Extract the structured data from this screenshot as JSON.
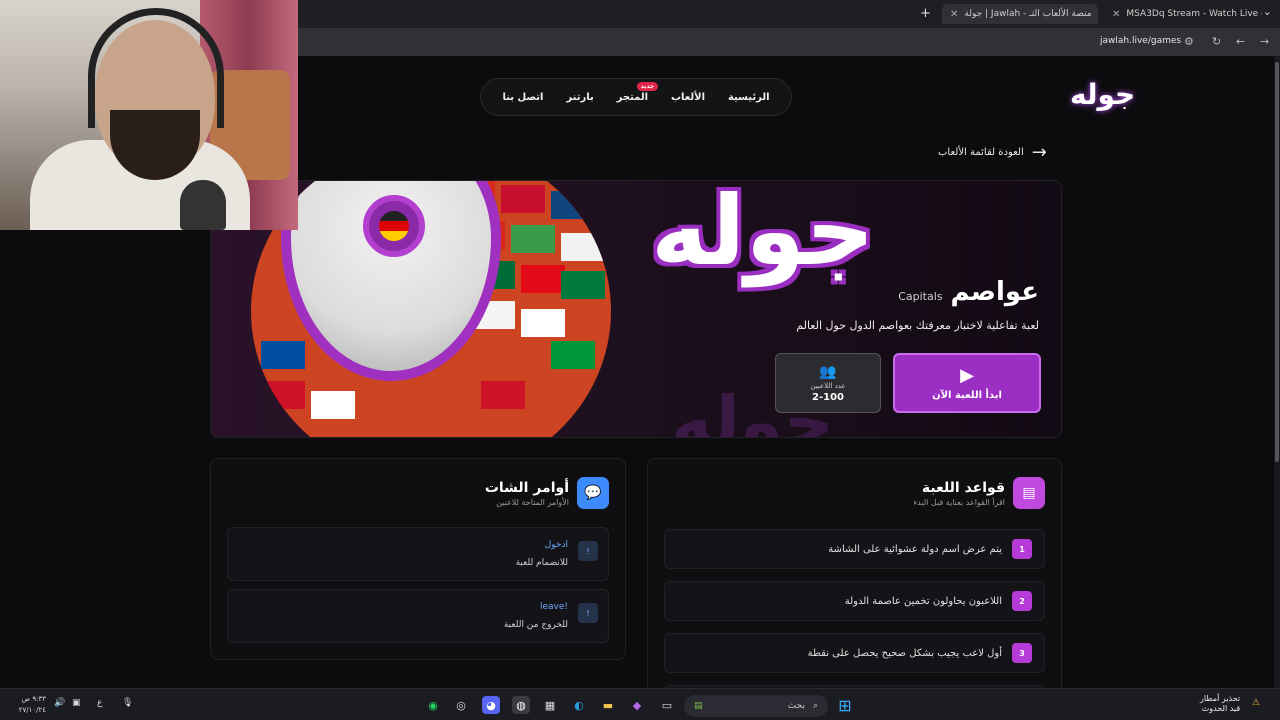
{
  "browser": {
    "tabs": [
      {
        "title": "MSA3Dq Stream - Watch Live o",
        "active": false
      },
      {
        "title": "جولة | Jawlah - منصة الألعاب التـ",
        "active": true
      }
    ],
    "new_tab": "+",
    "url": "jawlah.live/games"
  },
  "site": {
    "logo": "جوله",
    "nav": [
      {
        "label": "الرئيسية"
      },
      {
        "label": "الألعاب"
      },
      {
        "label": "المتجر",
        "badge": "جديد"
      },
      {
        "label": "بارتنر"
      },
      {
        "label": "اتصل بنا"
      }
    ],
    "back_link": "العودة لقائمة الألعاب"
  },
  "hero": {
    "brand_text": "جوله",
    "title_ar": "عواصم",
    "title_en": "Capitals",
    "description": "لعبة تفاعلية لاختبار معرفتك بعواصم الدول حول العالم",
    "start_button": "ابدأ اللعبة الآن",
    "players_label": "عدد اللاعبين",
    "players_value": "2-100"
  },
  "rules_card": {
    "title": "قواعد اللعبة",
    "subtitle": "اقرأ القواعد بعناية قبل البدء",
    "rules": [
      {
        "num": "1",
        "text": "يتم عرض اسم دولة عشوائية على الشاشة"
      },
      {
        "num": "2",
        "text": "اللاعبون يحاولون تخمين عاصمة الدولة"
      },
      {
        "num": "3",
        "text": "أول لاعب يجيب بشكل صحيح يحصل على نقطة"
      }
    ]
  },
  "chat_card": {
    "title": "أوامر الشات",
    "subtitle": "الأوامر المتاحة للاعبين",
    "commands": [
      {
        "num": "!",
        "code": "ادخول",
        "desc": "للانضمام للعبة"
      },
      {
        "num": "!",
        "code": "leave!",
        "desc": "للخروج من اللعبة"
      }
    ]
  },
  "taskbar": {
    "search_placeholder": "بحث",
    "clock_time": "٩:٣٣ ص",
    "clock_date": "٢٧/١٠/٢٤",
    "weather_line1": "تحذير أمطار",
    "weather_line2": "قيد الحدوث",
    "lang": "ع"
  },
  "colors": {
    "accent": "#9b2fc4",
    "badge": "#e2264a",
    "command_code": "#6aa5ff"
  }
}
